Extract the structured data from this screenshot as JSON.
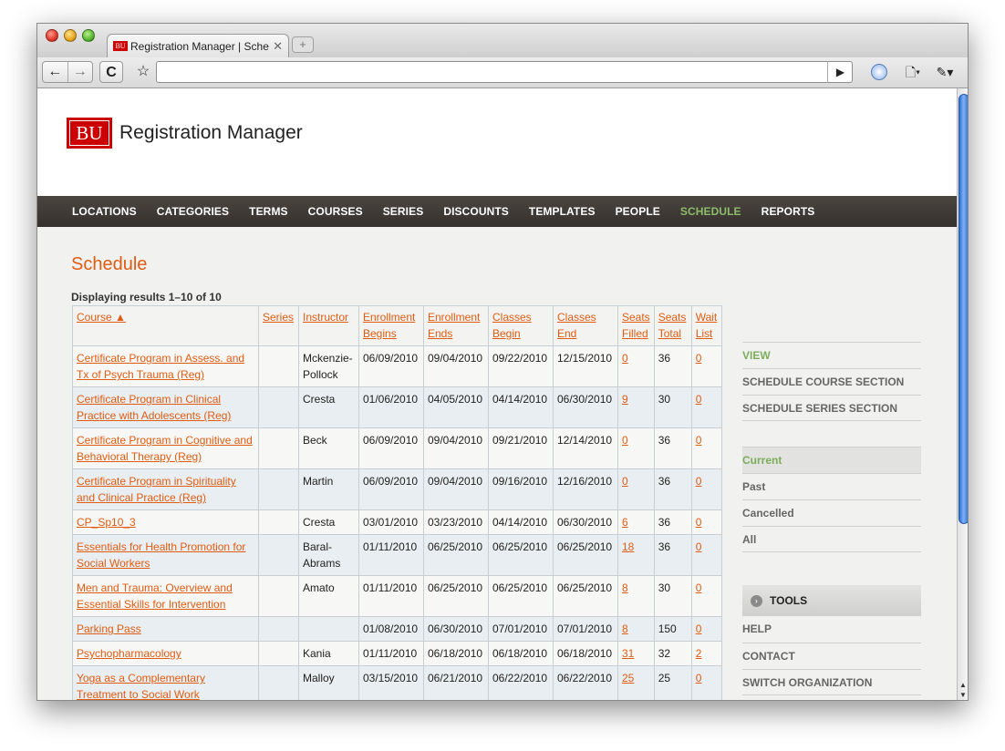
{
  "browser": {
    "tab_title": "Registration Manager | Sched",
    "tab_favicon_text": "BU",
    "close_glyph": "✕",
    "new_tab_glyph": "+",
    "back_glyph": "←",
    "forward_glyph": "→",
    "reload_glyph": "C",
    "star_glyph": "☆",
    "go_glyph": "▶",
    "page_glyph": "🗋▾",
    "wrench_glyph": "✎▾",
    "url": ""
  },
  "header": {
    "logo_mark": "BU",
    "logo_text": "Registration Manager"
  },
  "nav": [
    {
      "label": "LOCATIONS",
      "name": "nav-locations",
      "active": false
    },
    {
      "label": "CATEGORIES",
      "name": "nav-categories",
      "active": false
    },
    {
      "label": "TERMS",
      "name": "nav-terms",
      "active": false
    },
    {
      "label": "COURSES",
      "name": "nav-courses",
      "active": false
    },
    {
      "label": "SERIES",
      "name": "nav-series",
      "active": false
    },
    {
      "label": "DISCOUNTS",
      "name": "nav-discounts",
      "active": false
    },
    {
      "label": "TEMPLATES",
      "name": "nav-templates",
      "active": false
    },
    {
      "label": "PEOPLE",
      "name": "nav-people",
      "active": false
    },
    {
      "label": "SCHEDULE",
      "name": "nav-schedule",
      "active": true
    },
    {
      "label": "REPORTS",
      "name": "nav-reports",
      "active": false
    }
  ],
  "main": {
    "title": "Schedule",
    "results": "Displaying results 1–10 of 10"
  },
  "table": {
    "columns": [
      {
        "label": "Course ▲",
        "width": 204
      },
      {
        "label": "Series",
        "width": 44
      },
      {
        "label": "Instructor",
        "width": 66
      },
      {
        "label": "Enrollment Begins",
        "width": 71
      },
      {
        "label": "Enrollment Ends",
        "width": 71
      },
      {
        "label": "Classes Begin",
        "width": 71
      },
      {
        "label": "Classes End",
        "width": 71
      },
      {
        "label": "Seats Filled",
        "width": 39
      },
      {
        "label": "Seats Total",
        "width": 41
      },
      {
        "label": "Wait List",
        "width": 33
      }
    ],
    "rows": [
      {
        "course": "Certificate Program in Assess. and Tx of Psych Trauma (Reg)",
        "series": "",
        "instructor": "Mckenzie-Pollock",
        "enroll_begin": "06/09/2010",
        "enroll_end": "09/04/2010",
        "class_begin": "09/22/2010",
        "class_end": "12/15/2010",
        "filled": "0",
        "total": "36",
        "wait": "0"
      },
      {
        "course": "Certificate Program in Clinical Practice with Adolescents (Reg)",
        "series": "",
        "instructor": "Cresta",
        "enroll_begin": "01/06/2010",
        "enroll_end": "04/05/2010",
        "class_begin": "04/14/2010",
        "class_end": "06/30/2010",
        "filled": "9",
        "total": "30",
        "wait": "0"
      },
      {
        "course": "Certificate Program in Cognitive and Behavioral Therapy (Reg)",
        "series": "",
        "instructor": "Beck",
        "enroll_begin": "06/09/2010",
        "enroll_end": "09/04/2010",
        "class_begin": "09/21/2010",
        "class_end": "12/14/2010",
        "filled": "0",
        "total": "36",
        "wait": "0"
      },
      {
        "course": "Certificate Program in Spirituality and Clinical Practice (Reg)",
        "series": "",
        "instructor": "Martin",
        "enroll_begin": "06/09/2010",
        "enroll_end": "09/04/2010",
        "class_begin": "09/16/2010",
        "class_end": "12/16/2010",
        "filled": "0",
        "total": "36",
        "wait": "0"
      },
      {
        "course": "CP_Sp10_3",
        "series": "",
        "instructor": "Cresta",
        "enroll_begin": "03/01/2010",
        "enroll_end": "03/23/2010",
        "class_begin": "04/14/2010",
        "class_end": "06/30/2010",
        "filled": "6",
        "total": "36",
        "wait": "0"
      },
      {
        "course": "Essentials for Health Promotion for Social Workers",
        "series": "",
        "instructor": "Baral-Abrams",
        "enroll_begin": "01/11/2010",
        "enroll_end": "06/25/2010",
        "class_begin": "06/25/2010",
        "class_end": "06/25/2010",
        "filled": "18",
        "total": "36",
        "wait": "0"
      },
      {
        "course": "Men and Trauma: Overview and Essential Skills for Intervention",
        "series": "",
        "instructor": "Amato",
        "enroll_begin": "01/11/2010",
        "enroll_end": "06/25/2010",
        "class_begin": "06/25/2010",
        "class_end": "06/25/2010",
        "filled": "8",
        "total": "30",
        "wait": "0"
      },
      {
        "course": "Parking Pass",
        "series": "",
        "instructor": "",
        "enroll_begin": "01/08/2010",
        "enroll_end": "06/30/2010",
        "class_begin": "07/01/2010",
        "class_end": "07/01/2010",
        "filled": "8",
        "total": "150",
        "wait": "0"
      },
      {
        "course": "Psychopharmacology",
        "series": "",
        "instructor": "Kania",
        "enroll_begin": "01/11/2010",
        "enroll_end": "06/18/2010",
        "class_begin": "06/18/2010",
        "class_end": "06/18/2010",
        "filled": "31",
        "total": "32",
        "wait": "2"
      },
      {
        "course": "Yoga as a Complementary Treatment to Social Work",
        "series": "",
        "instructor": "Malloy",
        "enroll_begin": "03/15/2010",
        "enroll_end": "06/21/2010",
        "class_begin": "06/22/2010",
        "class_end": "06/22/2010",
        "filled": "25",
        "total": "25",
        "wait": "0"
      }
    ]
  },
  "sidebar": {
    "actions": [
      {
        "label": "VIEW",
        "active": true
      },
      {
        "label": "SCHEDULE COURSE SECTION",
        "active": false
      },
      {
        "label": "SCHEDULE SERIES SECTION",
        "active": false
      }
    ],
    "filters": [
      {
        "label": "Current",
        "active": true
      },
      {
        "label": "Past",
        "active": false
      },
      {
        "label": "Cancelled",
        "active": false
      },
      {
        "label": "All",
        "active": false
      }
    ],
    "tools_title": "TOOLS",
    "tools_icon": "›",
    "tools": [
      {
        "label": "HELP"
      },
      {
        "label": "CONTACT"
      },
      {
        "label": "SWITCH ORGANIZATION"
      }
    ]
  }
}
